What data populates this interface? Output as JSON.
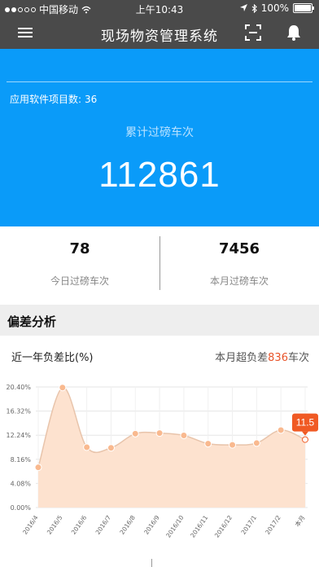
{
  "status_bar": {
    "carrier": "中国移动",
    "time": "上午10:43",
    "battery": "100%",
    "battery_level": 1.0
  },
  "navbar": {
    "title": "现场物资管理系统",
    "menu_icon": "menu-icon",
    "scan_icon": "scan-icon",
    "bell_icon": "bell-icon"
  },
  "hero": {
    "project_label": "应用软件项目数:",
    "project_count": "36",
    "total_label": "累计过磅车次",
    "total_value": "112861"
  },
  "stats": {
    "today_value": "78",
    "today_label": "今日过磅车次",
    "month_value": "7456",
    "month_label": "本月过磅车次"
  },
  "section": {
    "title": "偏差分析"
  },
  "chart_header": {
    "left": "近一年负差比(%)",
    "right_prefix": "本月超负差",
    "right_count": "836",
    "right_suffix": "车次"
  },
  "colors": {
    "accent": "#0a9bf9",
    "bar": "#4a4a4a",
    "area": "#fde2cf",
    "point": "#f9b98f",
    "tooltip": "#f05a24"
  },
  "chart_data": {
    "type": "area",
    "categories": [
      "2016/4",
      "2016/5",
      "2016/6",
      "2016/7",
      "2016/8",
      "2016/9",
      "2016/10",
      "2016/11",
      "2016/12",
      "2017/1",
      "2017/2",
      "本月"
    ],
    "values": [
      6.8,
      20.3,
      10.2,
      10.1,
      12.5,
      12.6,
      12.2,
      10.8,
      10.6,
      10.9,
      13.1,
      11.5
    ],
    "yticks": [
      "0.00%",
      "4.08%",
      "8.16%",
      "12.24%",
      "16.32%",
      "20.40%"
    ],
    "ylim": [
      0,
      20.4
    ],
    "highlight": {
      "index": 11,
      "label": "11.5"
    },
    "grid": true
  }
}
